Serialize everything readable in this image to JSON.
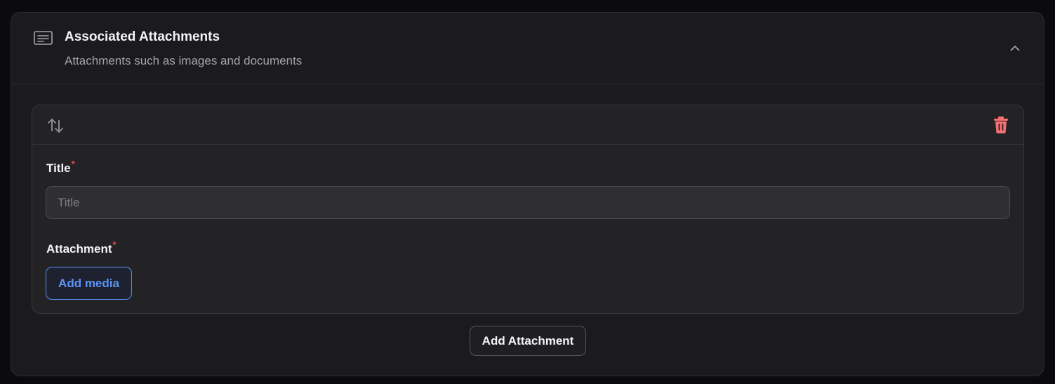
{
  "section": {
    "title": "Associated Attachments",
    "description": "Attachments such as images and documents",
    "icon": "document-lines-icon",
    "collapse_icon": "chevron-up-icon"
  },
  "item": {
    "reorder_icon": "arrows-up-down-icon",
    "delete_icon": "trash-icon",
    "delete_color": "#f87171",
    "fields": {
      "title_label": "Title",
      "title_required": "*",
      "title_placeholder": "Title",
      "title_value": "",
      "attachment_label": "Attachment",
      "attachment_required": "*",
      "add_media_label": "Add media"
    }
  },
  "actions": {
    "add_attachment_label": "Add Attachment"
  },
  "colors": {
    "accent": "#5b95f5",
    "required": "#ef4444",
    "background": "#1b1b1e"
  }
}
